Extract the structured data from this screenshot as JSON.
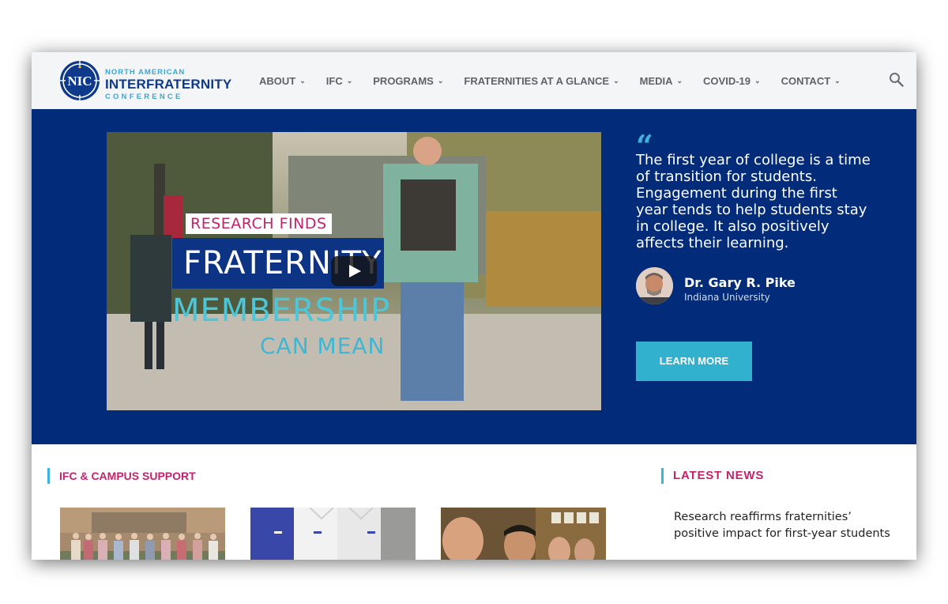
{
  "logo": {
    "initials": "NIC",
    "line1": "NORTH AMERICAN",
    "line2": "INTERFRATERNITY",
    "line3": "CONFERENCE"
  },
  "nav": {
    "items": [
      {
        "label": "ABOUT"
      },
      {
        "label": "IFC"
      },
      {
        "label": "PROGRAMS"
      },
      {
        "label": "FRATERNITIES AT A GLANCE"
      },
      {
        "label": "MEDIA"
      },
      {
        "label": "COVID-19"
      },
      {
        "label": "CONTACT"
      }
    ],
    "chevron": "⌄",
    "search_icon": "search-icon"
  },
  "hero": {
    "video": {
      "line1": "RESEARCH FINDS",
      "line2": "FRATERNITY",
      "line3": "MEMBERSHIP",
      "line4": "CAN MEAN",
      "play_icon": "play-icon"
    },
    "quote_mark": "“",
    "quote": "The first year of college is a time of transition for students. Engagement during the first year tends to help students stay in college. It also positively affects their learning.",
    "author_name": "Dr. Gary R. Pike",
    "author_org": "Indiana University",
    "button_label": "LEARN MORE"
  },
  "sections": {
    "left_title": "IFC & CAMPUS SUPPORT",
    "right_title": "LATEST NEWS"
  },
  "news": {
    "items": [
      {
        "title": "Research reaffirms fraternities’ positive impact for first-year students"
      }
    ]
  },
  "colors": {
    "hero_bg": "#022c7a",
    "accent": "#32b1cf",
    "heading_pink": "#c0246b",
    "nav_text": "#5f6368"
  }
}
